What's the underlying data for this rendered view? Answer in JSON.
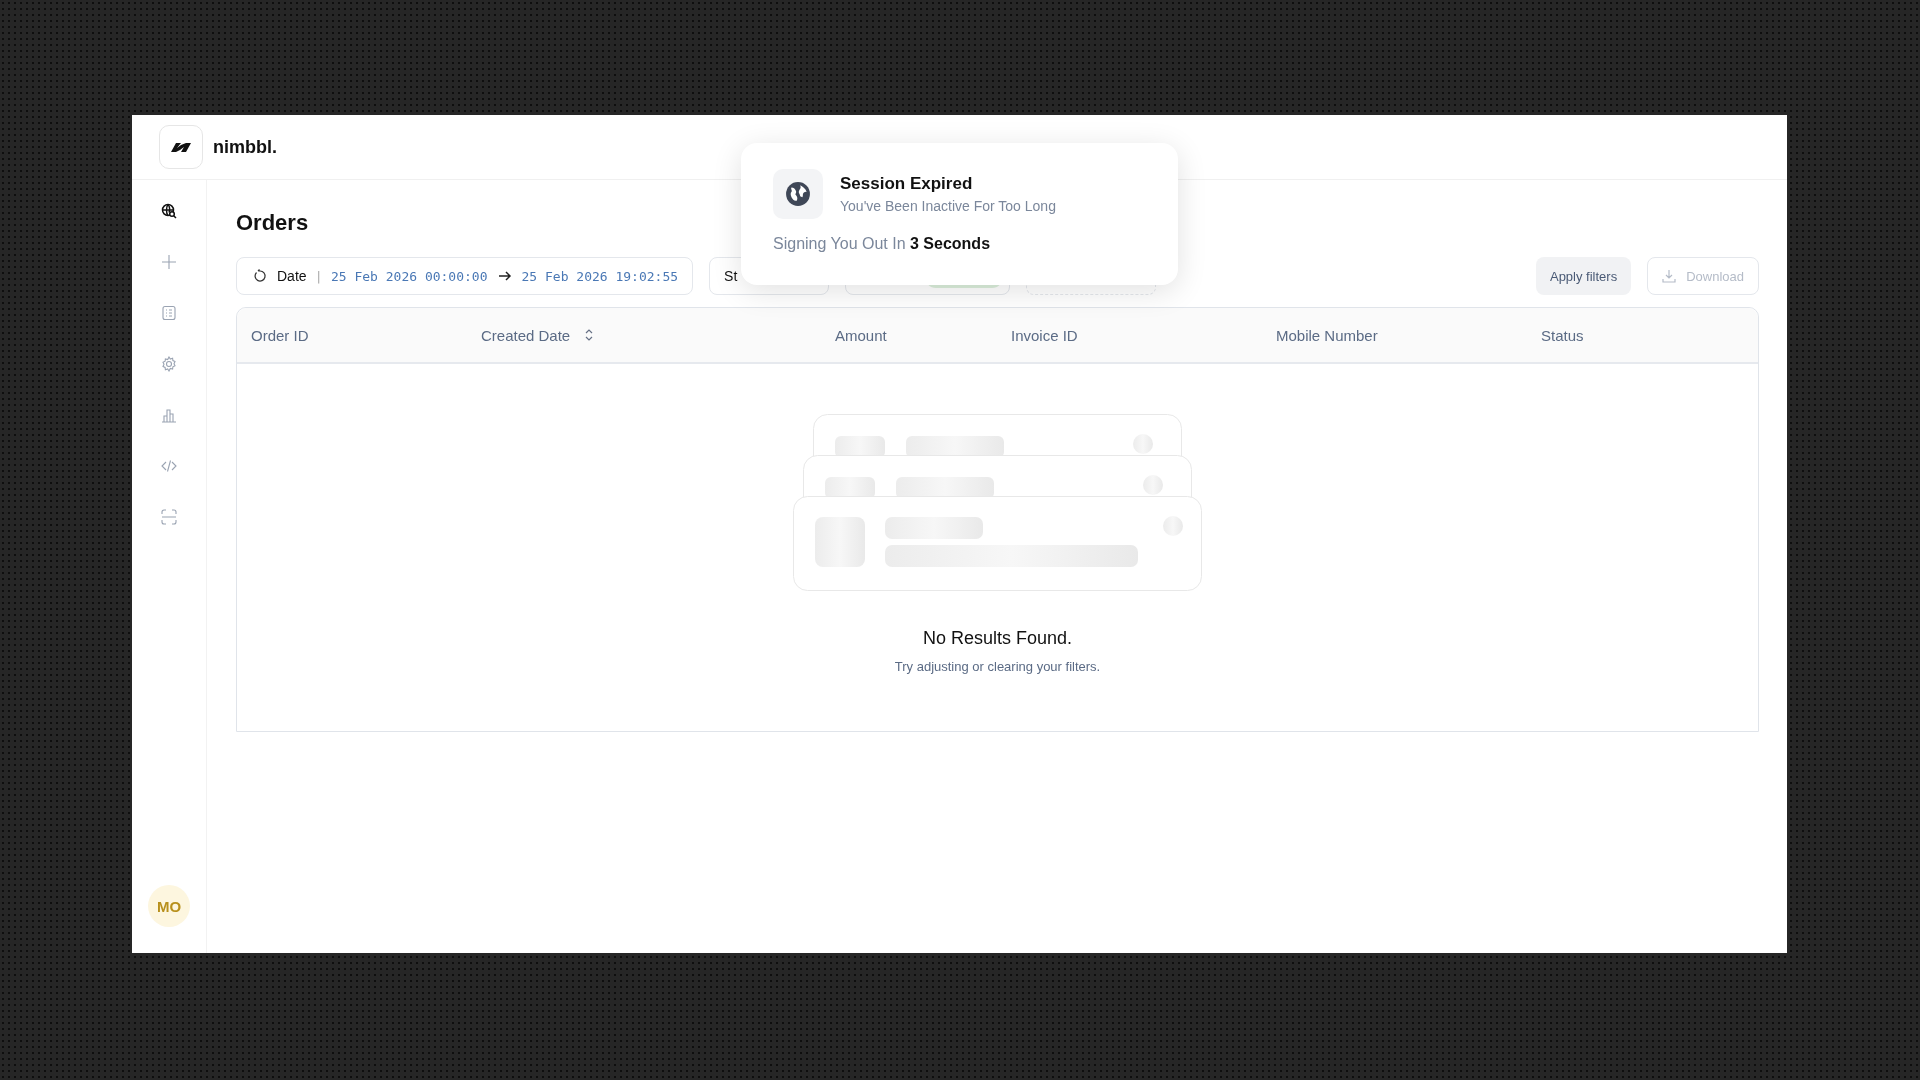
{
  "brand": {
    "name": "nimbbl."
  },
  "sidebar": {
    "items": [
      {
        "selected": true
      },
      {
        "selected": false
      },
      {
        "selected": false
      },
      {
        "selected": false
      },
      {
        "selected": false
      },
      {
        "selected": false
      },
      {
        "selected": false
      }
    ],
    "user": {
      "initials": "MO"
    }
  },
  "page": {
    "title": "Orders"
  },
  "filters": {
    "date": {
      "label": "Date",
      "from": "25 Feb 2026 00:00:00",
      "separator": "|",
      "to": "25 Feb 2026 19:02:55"
    },
    "chips": [
      {
        "label": "St"
      }
    ],
    "apply": "Apply filters",
    "download": {
      "label": "Download",
      "disabled": true
    }
  },
  "table": {
    "columns": [
      {
        "label": "Order ID",
        "sortable": false
      },
      {
        "label": "Created Date",
        "sortable": true
      },
      {
        "label": "Amount",
        "sortable": false
      },
      {
        "label": "Invoice ID",
        "sortable": false
      },
      {
        "label": "Mobile Number",
        "sortable": false
      },
      {
        "label": "Status",
        "sortable": false
      }
    ],
    "empty": {
      "title": "No Results Found.",
      "hint": "Try adjusting or clearing your filters."
    }
  },
  "toast": {
    "title": "Session Expired",
    "subtitle": "You've Been Inactive For Too Long",
    "message": "Signing You Out In **3 Seconds**"
  }
}
